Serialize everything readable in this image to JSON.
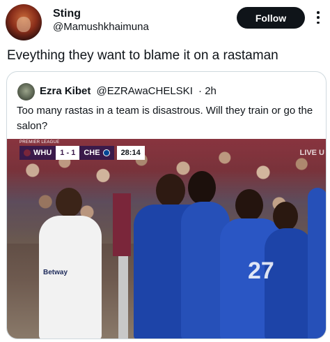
{
  "author": {
    "name": "Sting",
    "handle": "@Mamushkhaimuna",
    "avatar_icon": "profile-avatar"
  },
  "follow_label": "Follow",
  "more_icon": "more-options-icon",
  "tweet_text": "Eveything they want to blame it on a rastaman",
  "quoted": {
    "name": "Ezra Kibet",
    "handle": "@EZRAwaCHELSKI",
    "time": "· 2h",
    "text": "Too many rastas in a team is disastrous. Will they train or go the salon?",
    "media": {
      "league": "PREMIER LEAGUE",
      "home_team": "WHU",
      "home_score": "1",
      "separator": "-",
      "away_score": "1",
      "away_team": "CHE",
      "clock": "28:14",
      "live_label": "LIVE U",
      "sponsor": "Betway",
      "shirt_number": "27"
    }
  },
  "colors": {
    "follow_bg": "#0f1419",
    "border": "#cfd9de",
    "chelsea_blue": "#1d44a8",
    "west_ham": "#7a263a"
  }
}
